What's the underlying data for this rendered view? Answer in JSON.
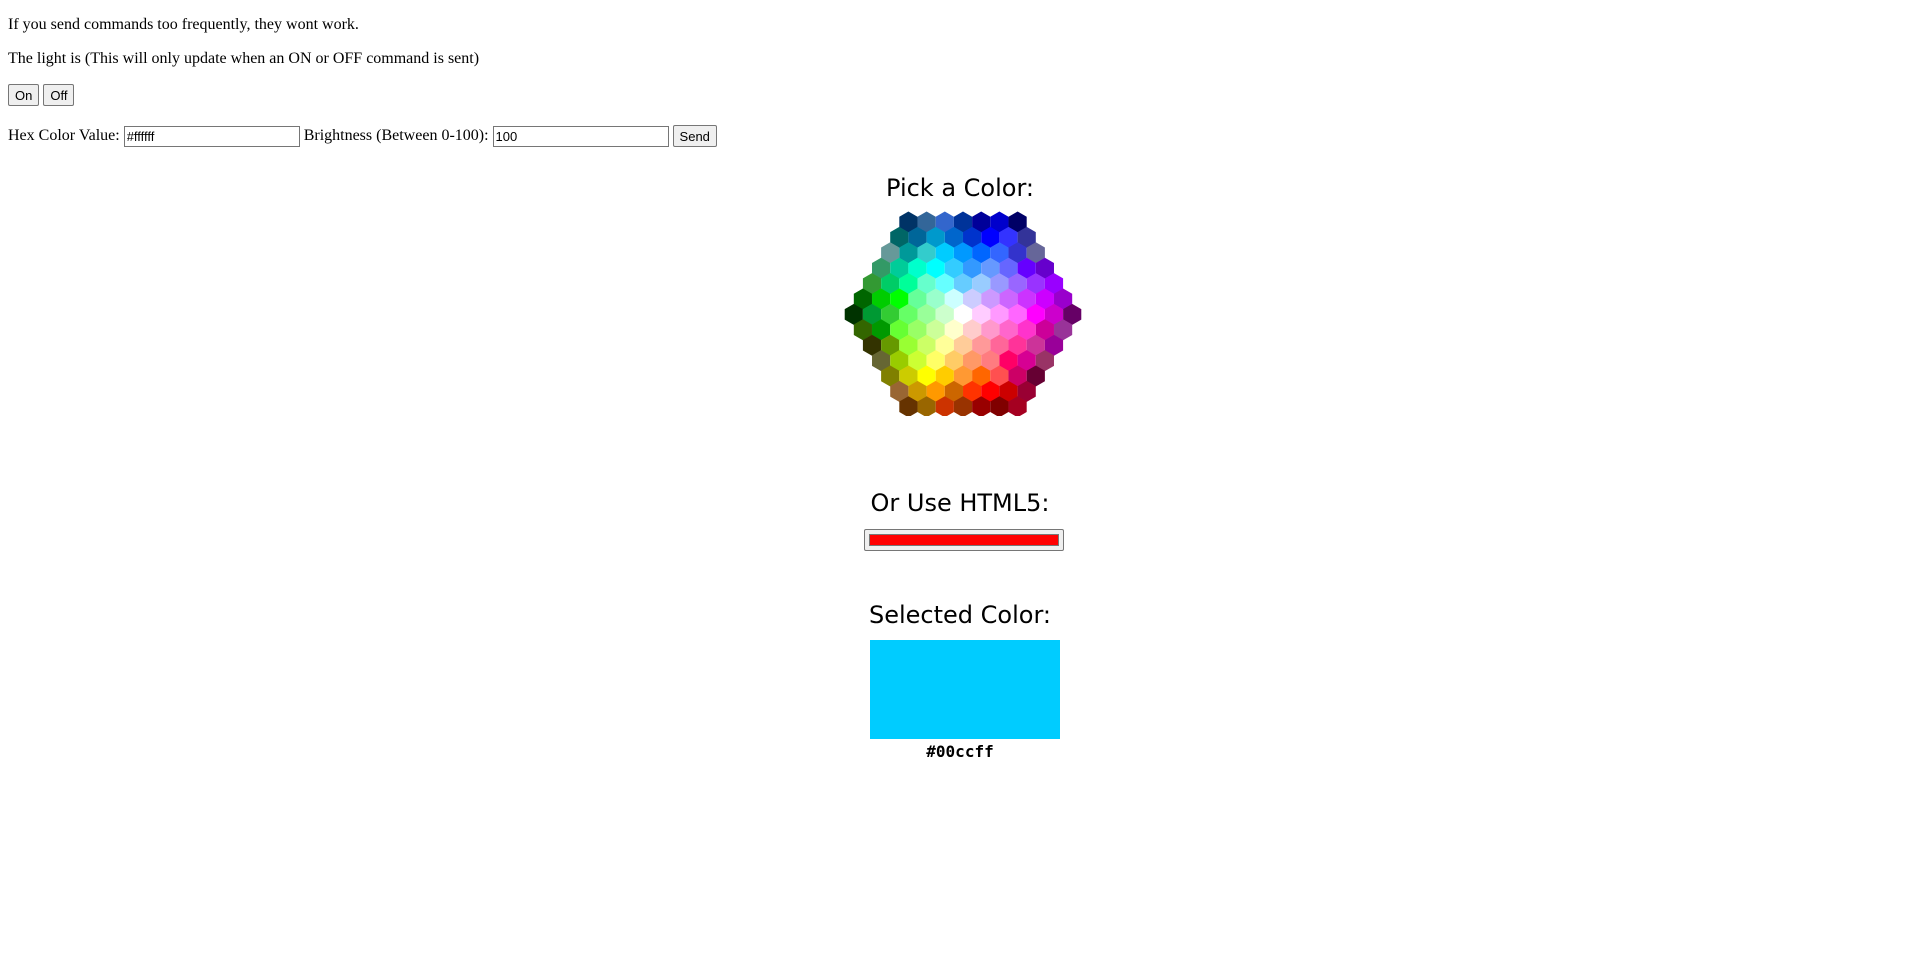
{
  "notice": "If you send commands too frequently, they wont work.",
  "light_status": "The light is (This will only update when an ON or OFF command is sent)",
  "buttons": {
    "on": "On",
    "off": "Off",
    "send": "Send"
  },
  "hex_label": "Hex Color Value:",
  "hex_value": "#ffffff",
  "brightness_label": "Brightness (Between 0-100):",
  "brightness_value": "100",
  "pick_heading": "Pick a Color:",
  "html5_heading": "Or Use HTML5:",
  "html5_color": "#ff0000",
  "selected_heading": "Selected Color:",
  "selected_color": "#00ccff",
  "selected_hex_text": "#00ccff",
  "palette_rows": [
    [
      "#003366",
      "#336699",
      "#3366CC",
      "#003399",
      "#000099",
      "#0000CC",
      "#000066"
    ],
    [
      "#006666",
      "#006699",
      "#0099CC",
      "#0066CC",
      "#0033CC",
      "#0000FF",
      "#3333FF",
      "#333399"
    ],
    [
      "#669999",
      "#009999",
      "#33CCCC",
      "#00CCFF",
      "#0099FF",
      "#0066FF",
      "#3366FF",
      "#3333CC",
      "#666699"
    ],
    [
      "#339966",
      "#00CC99",
      "#00FFCC",
      "#00FFFF",
      "#33CCFF",
      "#3399FF",
      "#6699FF",
      "#6666FF",
      "#6600FF",
      "#6600CC"
    ],
    [
      "#339933",
      "#00CC66",
      "#00FF99",
      "#66FFCC",
      "#66FFFF",
      "#66CCFF",
      "#99CCFF",
      "#9999FF",
      "#9966FF",
      "#9933FF",
      "#9900FF"
    ],
    [
      "#006600",
      "#00CC00",
      "#00FF00",
      "#66FF99",
      "#99FFCC",
      "#CCFFFF",
      "#CCCCFF",
      "#CC99FF",
      "#CC66FF",
      "#CC33FF",
      "#CC00FF",
      "#9900CC"
    ],
    [
      "#003300",
      "#009933",
      "#33CC33",
      "#66FF66",
      "#99FF99",
      "#CCFFCC",
      "#FFFFFF",
      "#FFCCFF",
      "#FF99FF",
      "#FF66FF",
      "#FF00FF",
      "#CC00CC",
      "#660066"
    ],
    [
      "#336600",
      "#009900",
      "#66FF33",
      "#99FF66",
      "#CCFF99",
      "#FFFFCC",
      "#FFCCCC",
      "#FF99CC",
      "#FF66CC",
      "#FF33CC",
      "#CC0099",
      "#993399"
    ],
    [
      "#333300",
      "#669900",
      "#99FF33",
      "#CCFF66",
      "#FFFF99",
      "#FFCC99",
      "#FF9999",
      "#FF6699",
      "#FF3399",
      "#CC3399",
      "#990099"
    ],
    [
      "#666633",
      "#99CC00",
      "#CCFF33",
      "#FFFF66",
      "#FFCC66",
      "#FF9966",
      "#FF7C80",
      "#FF0066",
      "#D60093",
      "#993366"
    ],
    [
      "#808000",
      "#CCCC00",
      "#FFFF00",
      "#FFCC00",
      "#FF9933",
      "#FF6600",
      "#FF5050",
      "#CC0066",
      "#660033"
    ],
    [
      "#996633",
      "#CC9900",
      "#FF9900",
      "#CC6600",
      "#FF3300",
      "#FF0000",
      "#CC0000",
      "#990033"
    ],
    [
      "#663300",
      "#996600",
      "#CC3300",
      "#993300",
      "#990000",
      "#800000",
      "#A50021"
    ]
  ]
}
